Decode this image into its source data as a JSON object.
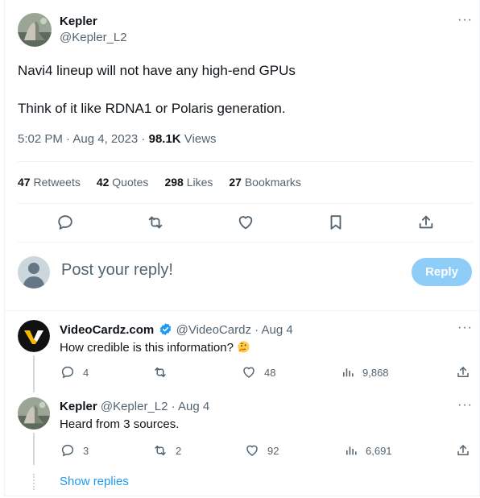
{
  "main_tweet": {
    "author_name": "Kepler",
    "author_handle": "@Kepler_L2",
    "line1": "Navi4 lineup will not have any high-end GPUs",
    "line2": "Think of it like RDNA1 or Polaris generation.",
    "timestamp": "5:02 PM · Aug 4, 2023 · ",
    "views_count": "98.1K",
    "views_label": " Views",
    "stats": {
      "retweets_count": "47",
      "retweets_label": "Retweets",
      "quotes_count": "42",
      "quotes_label": "Quotes",
      "likes_count": "298",
      "likes_label": "Likes",
      "bookmarks_count": "27",
      "bookmarks_label": "Bookmarks"
    },
    "more": "···"
  },
  "reply_box": {
    "placeholder": "Post your reply!",
    "button_label": "Reply"
  },
  "replies": [
    {
      "author_name": "VideoCardz.com",
      "verified": true,
      "author_handle": "@VideoCardz",
      "sep": " · ",
      "date": "Aug 4",
      "text": "How credible is this information? ",
      "emoji": "thinking-face",
      "reply_count": "4",
      "retweet_count": "",
      "like_count": "48",
      "view_count": "9,868",
      "more": "···"
    },
    {
      "author_name": "Kepler",
      "verified": false,
      "author_handle": "@Kepler_L2",
      "sep": " · ",
      "date": "Aug 4",
      "text": "Heard from 3 sources.",
      "reply_count": "3",
      "retweet_count": "2",
      "like_count": "92",
      "view_count": "6,691",
      "more": "···"
    }
  ],
  "show_replies": "Show replies",
  "colors": {
    "accent": "#1d9bf0",
    "reply_button": "#8ecdf8",
    "muted": "#536471",
    "text": "#0f1419"
  },
  "icons": [
    "comment-icon",
    "retweet-icon",
    "heart-icon",
    "bookmark-icon",
    "share-icon",
    "views-icon",
    "verified-badge-icon",
    "more-icon"
  ]
}
